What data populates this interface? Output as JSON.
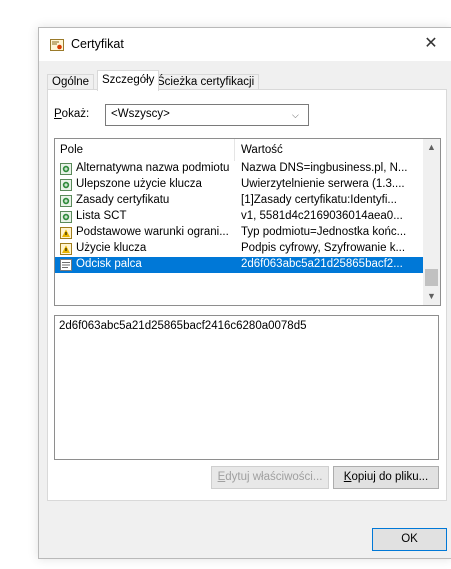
{
  "dialog": {
    "title": "Certyfikat",
    "close_label": "✕",
    "tabs": [
      {
        "label": "Ogólne"
      },
      {
        "label": "Szczegóły"
      },
      {
        "label": "Ścieżka certyfikacji"
      }
    ],
    "show": {
      "label_prefix": "P",
      "label_rest": "okaż:",
      "selected": "<Wszyscy>"
    },
    "fields_list": {
      "columns": [
        "Pole",
        "Wartość"
      ],
      "rows": [
        {
          "field": "Alternatywna nazwa podmiotu",
          "value": "Nazwa DNS=ingbusiness.pl, N...",
          "icon": "extension-icon"
        },
        {
          "field": "Ulepszone użycie klucza",
          "value": "Uwierzytelnienie serwera (1.3....",
          "icon": "extension-icon"
        },
        {
          "field": "Zasady certyfikatu",
          "value": "[1]Zasady certyfikatu:Identyfi...",
          "icon": "extension-icon"
        },
        {
          "field": "Lista SCT",
          "value": "v1, 5581d4c2169036014aea0...",
          "icon": "extension-icon"
        },
        {
          "field": "Podstawowe warunki ograni...",
          "value": "Typ podmiotu=Jednostka końc...",
          "icon": "critical-extension-icon"
        },
        {
          "field": "Użycie klucza",
          "value": "Podpis cyfrowy, Szyfrowanie k...",
          "icon": "critical-extension-icon"
        },
        {
          "field": "Odcisk palca",
          "value": "2d6f063abc5a21d25865bacf2...",
          "icon": "property-icon"
        }
      ],
      "selected_index": 6
    },
    "detail_value": "2d6f063abc5a21d25865bacf2416c6280a0078d5",
    "buttons": {
      "edit_properties": {
        "prefix": "",
        "accel": "E",
        "rest": "dytuj właściwości..."
      },
      "copy_to_file": {
        "prefix": "",
        "accel": "K",
        "rest": "opiuj do pliku..."
      },
      "ok": "OK"
    },
    "colors": {
      "selection": "#0078d7",
      "accent": "#0078d7"
    }
  }
}
